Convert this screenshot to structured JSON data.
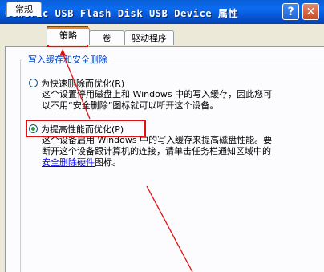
{
  "window": {
    "title": "Generic USB Flash Disk USB Device 属性",
    "help_glyph": "?",
    "close_glyph": "✕"
  },
  "tabs": [
    {
      "label": "常规"
    },
    {
      "label": "策略"
    },
    {
      "label": "卷"
    },
    {
      "label": "驱动程序"
    }
  ],
  "group": {
    "title": "写入缓存和安全删除"
  },
  "options": [
    {
      "label": "为快速删除而优化(R)",
      "selected": false,
      "desc_line1": "这个设置停用磁盘上和 Windows 中的写入缓存，因此您可",
      "desc_line2": "以不用“安全删除”图标就可以断开这个设备。"
    },
    {
      "label": "为提高性能而优化(P)",
      "selected": true,
      "desc_line1": "这个设备启用 Windows 中的写入缓存来提高磁盘性能。要",
      "desc_line2": "断开这个设备跟计算机的连接，请单击任务栏通知区域中的",
      "desc_link": "安全删除硬件",
      "desc_after_link": "图标。"
    }
  ],
  "colors": {
    "title_bar": "#0b6bf0",
    "annotation": "#e01010",
    "radio_dot": "#2f9c2f",
    "group_label": "#0046d5"
  }
}
